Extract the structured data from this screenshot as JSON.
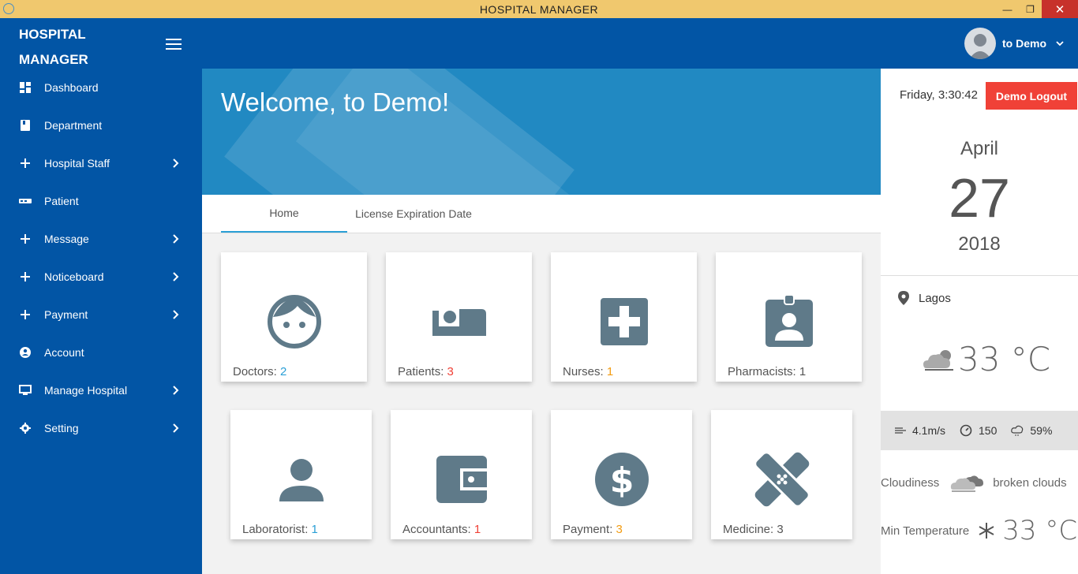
{
  "window": {
    "title": "HOSPITAL MANAGER"
  },
  "sidebar": {
    "brand_line1": "HOSPITAL",
    "brand_line2": "MANAGER",
    "items": [
      {
        "label": "Dashboard",
        "icon": "dashboard-icon",
        "has_submenu": false
      },
      {
        "label": "Department",
        "icon": "book-icon",
        "has_submenu": false
      },
      {
        "label": "Hospital Staff",
        "icon": "plus-icon",
        "has_submenu": true
      },
      {
        "label": "Patient",
        "icon": "bed-icon",
        "has_submenu": false
      },
      {
        "label": "Message",
        "icon": "plus-icon",
        "has_submenu": true
      },
      {
        "label": "Noticeboard",
        "icon": "plus-icon",
        "has_submenu": true
      },
      {
        "label": "Payment",
        "icon": "plus-icon",
        "has_submenu": true
      },
      {
        "label": "Account",
        "icon": "account-circle-icon",
        "has_submenu": false
      },
      {
        "label": "Manage Hospital",
        "icon": "monitor-icon",
        "has_submenu": true
      },
      {
        "label": "Setting",
        "icon": "gear-icon",
        "has_submenu": true
      }
    ]
  },
  "header": {
    "user_name": "to Demo"
  },
  "main": {
    "welcome": "Welcome, to Demo!",
    "tabs": [
      {
        "label": "Home",
        "active": true
      },
      {
        "label": "License Expiration Date",
        "active": false
      }
    ],
    "cards": [
      {
        "label": "Doctors: ",
        "count": "2",
        "color": "#2a9fd6",
        "icon": "face-icon"
      },
      {
        "label": "Patients: ",
        "count": "3",
        "color": "#f04137",
        "icon": "hotel-bed-icon"
      },
      {
        "label": "Nurses: ",
        "count": "1",
        "color": "#f39c12",
        "icon": "medical-cross-icon"
      },
      {
        "label": "Pharmacists: ",
        "count": "1",
        "color": "#555555",
        "icon": "badge-person-icon"
      },
      {
        "label": "Laboratorist: ",
        "count": "1",
        "color": "#2a9fd6",
        "icon": "person-icon"
      },
      {
        "label": "Accountants: ",
        "count": "1",
        "color": "#f04137",
        "icon": "wallet-icon"
      },
      {
        "label": "Payment: ",
        "count": "3",
        "color": "#f39c12",
        "icon": "dollar-icon"
      },
      {
        "label": "Medicine: ",
        "count": "3",
        "color": "#555555",
        "icon": "bandage-icon"
      }
    ]
  },
  "right_panel": {
    "clock": "Friday, 3:30:42",
    "logout_label": "Demo Logout",
    "month": "April",
    "day": "27",
    "year": "2018",
    "location": "Lagos",
    "temperature": "33 °C",
    "wind": "4.1m/s",
    "pressure": "150",
    "humidity": "59%",
    "cloudiness_label": "Cloudiness",
    "cloudiness_value": "broken clouds",
    "min_temp_label": "Min Temperature",
    "min_temp_value": "33 °C"
  },
  "colors": {
    "primary": "#0255a5",
    "banner": "#2189c2",
    "icon_gray": "#5f7a89",
    "logout": "#f04137",
    "titlebar": "#f0c86e"
  }
}
